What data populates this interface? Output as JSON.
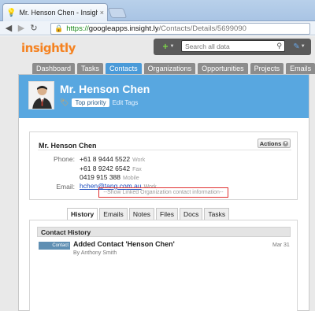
{
  "browser": {
    "tab_title": "Mr. Henson Chen - Insightl",
    "tab_close": "×",
    "url_https": "https://",
    "url_host": "googleapps.insight.ly",
    "url_path": "/Contacts/Details/5699090"
  },
  "app": {
    "logo": "insightly",
    "search_placeholder": "Search all data",
    "add_symbol": "+",
    "nav_tabs": [
      "Dashboard",
      "Tasks",
      "Contacts",
      "Organizations",
      "Opportunities",
      "Projects",
      "Emails"
    ],
    "active_tab": "Contacts"
  },
  "contact": {
    "name": "Mr. Henson Chen",
    "tag": "Top priority",
    "edit_tags": "Edit Tags",
    "actions_label": "Actions",
    "phone_label": "Phone:",
    "phones": [
      {
        "number": "+61 8 9444 5522",
        "type": "Work"
      },
      {
        "number": "+61 8 9242 6542",
        "type": "Fax"
      },
      {
        "number": "0419 915 388",
        "type": "Mobile"
      }
    ],
    "email_label": "Email:",
    "email": "hchen@tang.com.au",
    "email_type": "Work",
    "show_linked": "--Show Linked Organization contact information--"
  },
  "content_tabs": [
    "History",
    "Emails",
    "Notes",
    "Files",
    "Docs",
    "Tasks"
  ],
  "history": {
    "header": "Contact History",
    "item_badge": "Contact",
    "item_title": "Added Contact 'Henson Chen'",
    "item_by": "By Anthony Smith",
    "item_date": "Mar 31"
  }
}
